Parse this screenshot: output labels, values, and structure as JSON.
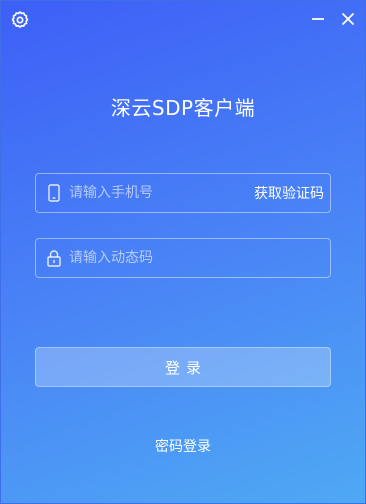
{
  "app": {
    "title": "深云SDP客户端"
  },
  "titlebar": {
    "settings_icon": "gear-icon",
    "minimize_icon": "minimize-icon",
    "close_icon": "close-icon"
  },
  "form": {
    "phone": {
      "icon": "mobile-phone-icon",
      "value": "",
      "placeholder": "请输入手机号",
      "get_code_label": "获取验证码"
    },
    "code": {
      "icon": "lock-icon",
      "value": "",
      "placeholder": "请输入动态码"
    },
    "login_label": "登录"
  },
  "footer": {
    "password_login_label": "密码登录"
  },
  "colors": {
    "gradient_start": "#3d5ff7",
    "gradient_end": "#4ea9f4",
    "text": "#ffffff"
  }
}
